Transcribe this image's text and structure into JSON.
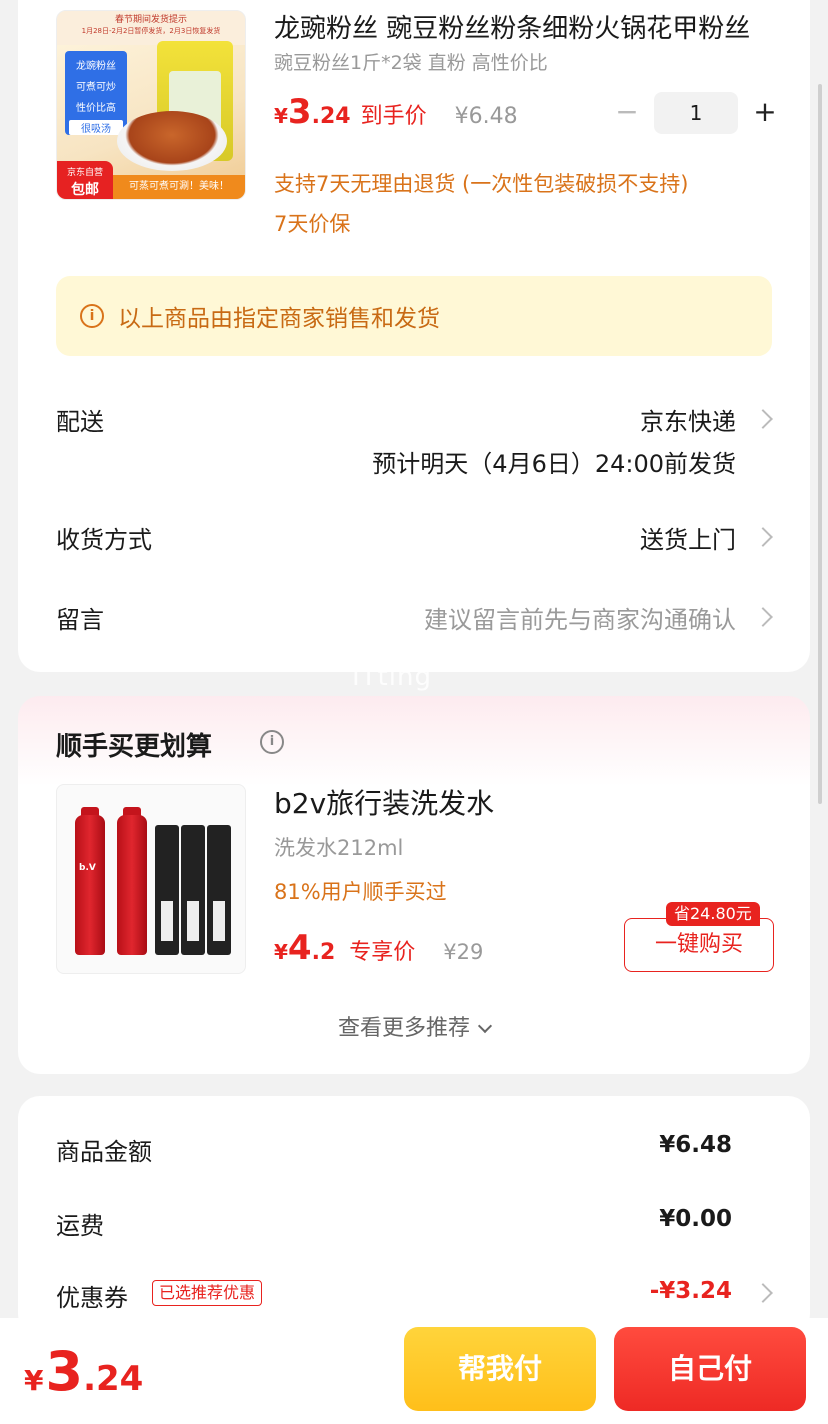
{
  "product": {
    "title": "龙豌粉丝 豌豆粉丝粉条细粉火锅花甲粉丝",
    "subtitle": "豌豆粉丝1斤*2袋 直粉 高性价比",
    "price_yen": "¥",
    "price_int": "3",
    "price_dec": ".24",
    "price_tag": "到手价",
    "original_price": "¥6.48",
    "quantity": "1",
    "minus": "−",
    "plus": "+",
    "policy_return": "支持7天无理由退货 (一次性包装破损不支持)",
    "policy_price": "7天价保",
    "image": {
      "header_line1": "春节期间发货提示",
      "header_line2": "1月28日-2月2日暂停发货，2月3日恢复发货",
      "blue_1": "龙豌粉丝",
      "blue_2": "可煮可炒",
      "blue_3": "性价比高",
      "blue_4": "很吸汤",
      "tag_1": "京东自营",
      "tag_2": "包邮",
      "footer": "可蒸可煮可涮！美味！"
    }
  },
  "notice": {
    "icon": "info-icon",
    "text": "以上商品由指定商家销售和发货"
  },
  "delivery": {
    "label": "配送",
    "carrier": "京东快递",
    "estimate": "预计明天（4月6日）24:00前发货"
  },
  "receive": {
    "label": "收货方式",
    "value": "送货上门"
  },
  "message": {
    "label": "留言",
    "placeholder": "建议留言前先与商家沟通确认"
  },
  "watermark": "ITting",
  "recommend": {
    "title": "顺手买更划算",
    "item": {
      "name": "b2v旅行装洗发水",
      "spec": "洗发水212ml",
      "stat": "81%用户顺手买过",
      "price_yen": "¥",
      "price_int": "4",
      "price_dec": ".2",
      "price_tag": "专享价",
      "original_price": "¥29",
      "save_badge": "省24.80元",
      "buy_label": "一键购买",
      "brand_mark": "b.V"
    },
    "more": "查看更多推荐"
  },
  "summary": {
    "goods_label": "商品金额",
    "goods_value": "¥6.48",
    "shipping_label": "运费",
    "shipping_value": "¥0.00",
    "coupon_label": "优惠券",
    "coupon_badge": "已选推荐优惠",
    "coupon_value": "-¥3.24"
  },
  "bottom": {
    "total_yen": "¥",
    "total_int": "3",
    "total_dec": ".24",
    "help_pay": "帮我付",
    "self_pay": "自己付"
  },
  "colors": {
    "accent_red": "#e8231f",
    "accent_orange": "#d9731a",
    "notice_bg": "#fff8d6",
    "help_btn": "#ffc61f",
    "self_btn": "#f23128"
  }
}
